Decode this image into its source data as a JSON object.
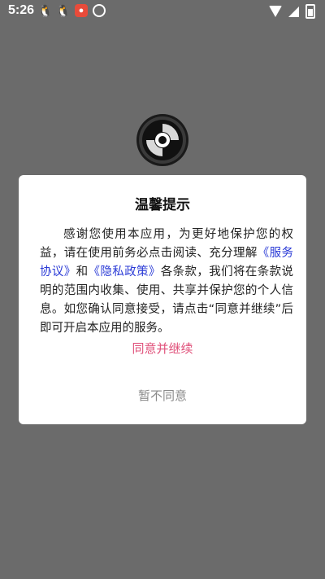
{
  "status_bar": {
    "time": "5:26",
    "notification_icons": [
      "qq-icon",
      "qq-icon",
      "app-notification-icon",
      "circle-app-icon"
    ],
    "system_icons": [
      "wifi-icon",
      "signal-icon",
      "battery-icon"
    ]
  },
  "colors": {
    "overlay": "#6b6b6b",
    "link": "#2b3bd6",
    "agree": "#e0507a",
    "disagree": "#8a8a8a"
  },
  "dialog": {
    "title": "温馨提示",
    "text_1": "感谢您使用本应用，为更好地保护您的权益，请在使用前务必点击阅读、充分理解",
    "link_service": "《服务协议》",
    "text_2": "和",
    "link_privacy": "《隐私政策》",
    "text_3": "各条款，我们将在条款说明的范围内收集、使用、共享并保护您的个人信息。如您确认同意接受，请点击“同意并继续”后即可开启本应用的服务。",
    "agree_label": "同意并继续",
    "disagree_label": "暂不同意"
  }
}
